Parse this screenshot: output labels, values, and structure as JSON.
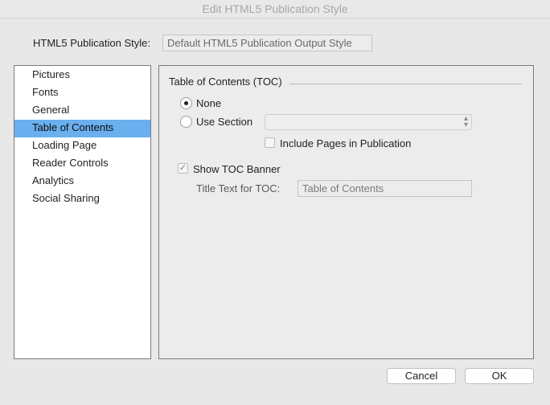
{
  "window": {
    "title": "Edit HTML5 Publication Style"
  },
  "style": {
    "label": "HTML5 Publication Style:",
    "value": "Default HTML5 Publication Output Style"
  },
  "sidebar": {
    "items": [
      {
        "label": "Pictures"
      },
      {
        "label": "Fonts"
      },
      {
        "label": "General"
      },
      {
        "label": "Table of Contents",
        "selected": true
      },
      {
        "label": "Loading Page"
      },
      {
        "label": "Reader Controls"
      },
      {
        "label": "Analytics"
      },
      {
        "label": "Social Sharing"
      }
    ]
  },
  "toc": {
    "group_title": "Table of Contents (TOC)",
    "option_none": "None",
    "option_use_section": "Use Section",
    "selected_option": "None",
    "section_select_value": "",
    "include_pages_label": "Include Pages in Publication",
    "include_pages_checked": false,
    "show_banner_label": "Show TOC Banner",
    "show_banner_checked": true,
    "title_text_label": "Title Text for TOC:",
    "title_text_value": "Table of Contents"
  },
  "buttons": {
    "cancel": "Cancel",
    "ok": "OK"
  },
  "icons": {
    "select_arrows": "chevron-up-down-icon",
    "checkmark": "checkmark-icon"
  },
  "colors": {
    "selection": "#6aafee",
    "background": "#e8e8e8"
  }
}
